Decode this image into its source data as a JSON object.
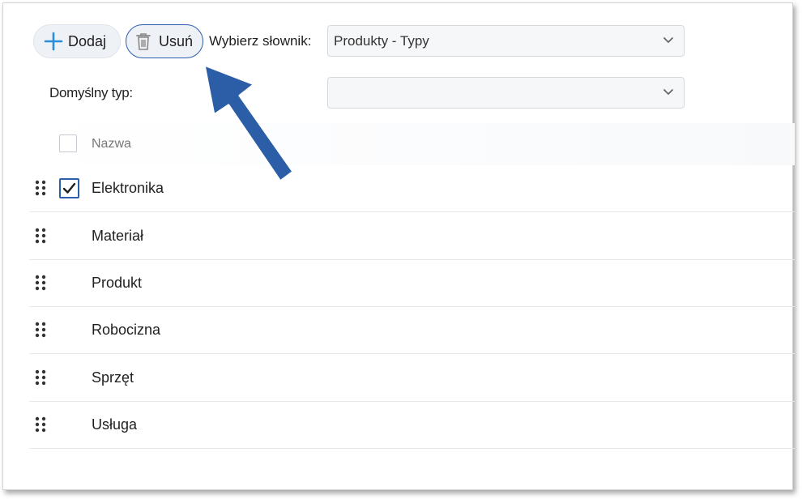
{
  "toolbar": {
    "add_label": "Dodaj",
    "delete_label": "Usuń",
    "dictionary_label": "Wybierz słownik:",
    "dictionary_value": "Produkty - Typy"
  },
  "default_type": {
    "label": "Domyślny typ:",
    "value": ""
  },
  "table": {
    "column_name": "Nazwa",
    "rows": [
      {
        "name": "Elektronika",
        "checked": true
      },
      {
        "name": "Materiał",
        "checked": false
      },
      {
        "name": "Produkt",
        "checked": false
      },
      {
        "name": "Robocizna",
        "checked": false
      },
      {
        "name": "Sprzęt",
        "checked": false
      },
      {
        "name": "Usługa",
        "checked": false
      }
    ]
  },
  "colors": {
    "accent": "#2b5fae",
    "add_icon": "#2a8fd8",
    "arrow": "#2c5ea8"
  },
  "icons": [
    "plus-icon",
    "trash-icon",
    "chevron-down-icon",
    "drag-handle-icon",
    "check-icon",
    "arrow-pointer-icon"
  ]
}
